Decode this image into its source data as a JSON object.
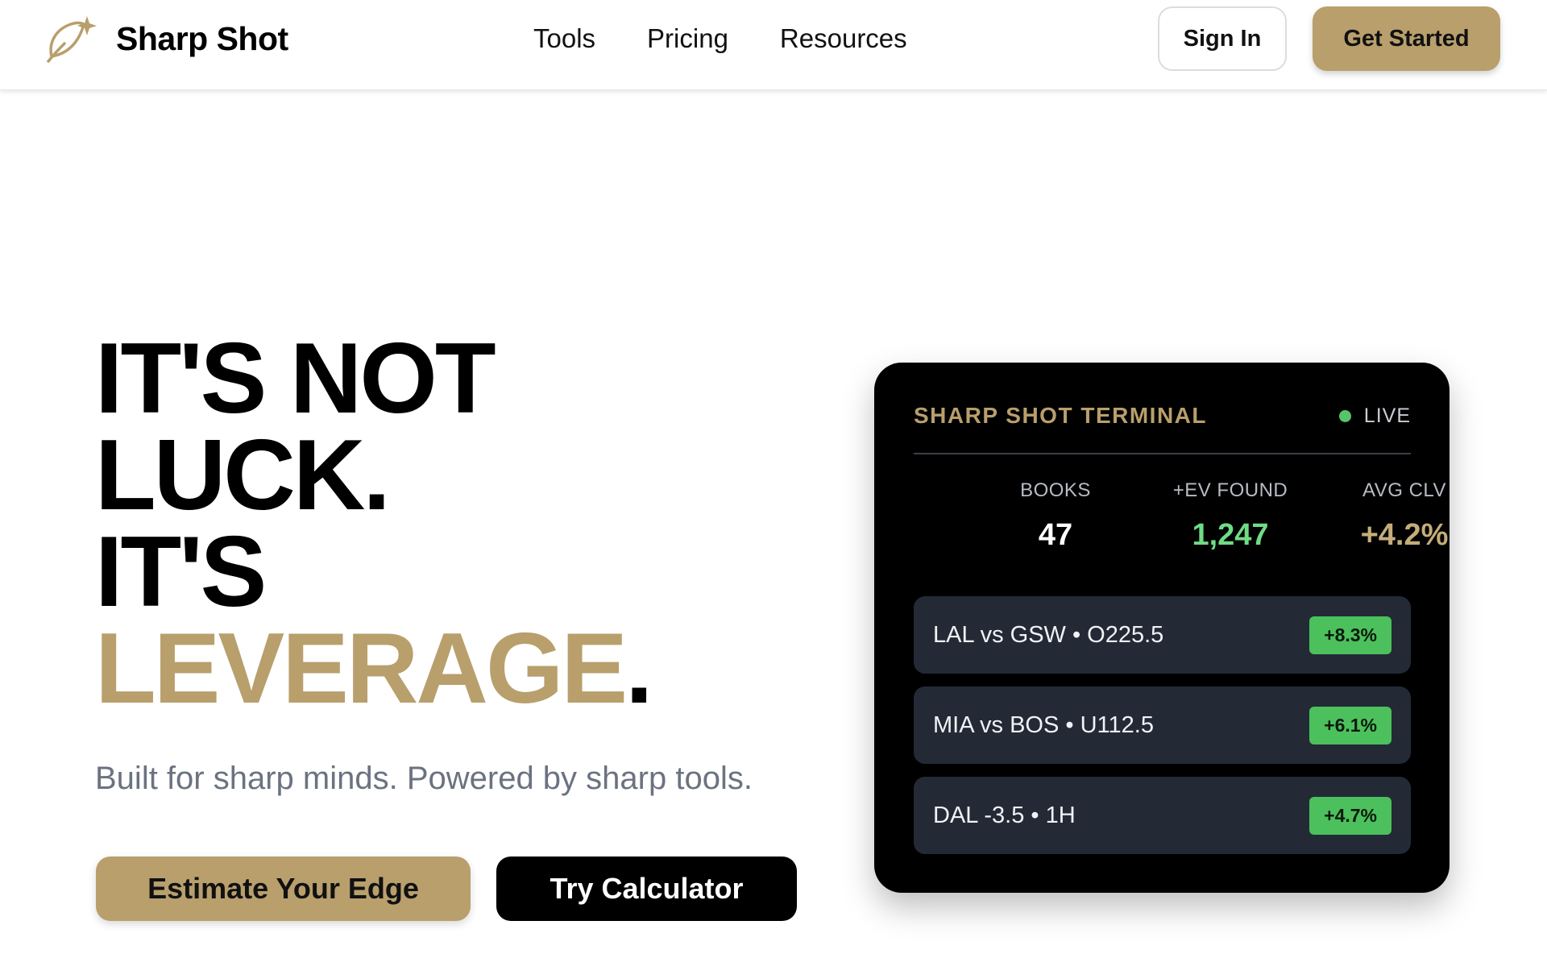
{
  "header": {
    "brand": "Sharp Shot",
    "nav": [
      "Tools",
      "Pricing",
      "Resources"
    ],
    "sign_in": "Sign In",
    "get_started": "Get Started"
  },
  "hero": {
    "line1": "IT'S NOT",
    "line2": "LUCK.",
    "line3": "IT'S",
    "line4_accent": "LEVERAGE",
    "line4_end": ".",
    "subtitle": "Built for sharp minds. Powered by sharp tools.",
    "cta_primary": "Estimate Your Edge",
    "cta_secondary": "Try Calculator"
  },
  "terminal": {
    "title": "SHARP SHOT TERMINAL",
    "status": "LIVE",
    "stats": [
      {
        "label": "BOOKS",
        "value": "47"
      },
      {
        "label": "+EV FOUND",
        "value": "1,247"
      },
      {
        "label": "AVG CLV",
        "value": "+4.2%"
      }
    ],
    "bets": [
      {
        "label": "LAL vs GSW • O225.5",
        "edge": "+8.3%"
      },
      {
        "label": "MIA vs BOS • U112.5",
        "edge": "+6.1%"
      },
      {
        "label": "DAL -3.5 • 1H",
        "edge": "+4.7%"
      }
    ]
  },
  "colors": {
    "accent_gold": "#b89f6c",
    "live_green": "#57c46a",
    "positive_green": "#6fdc85",
    "badge_green": "#4cc05c",
    "card_bg": "#000000",
    "row_bg": "#232a36"
  },
  "icons": {
    "logo": "sparkle-feather-logo-icon",
    "live": "status-dot-icon"
  }
}
